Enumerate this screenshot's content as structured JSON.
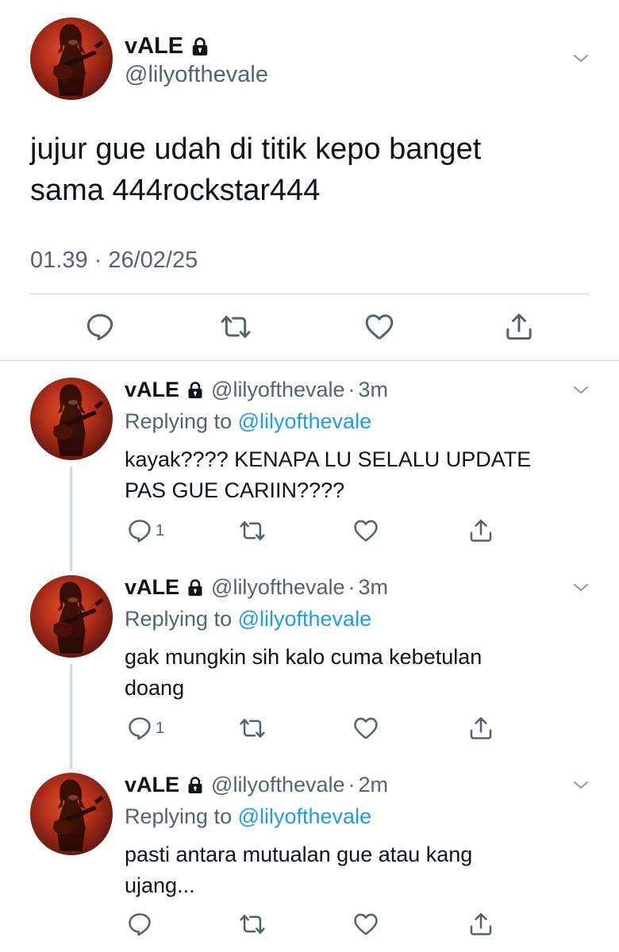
{
  "main_tweet": {
    "name": "vALE",
    "handle": "@lilyofthevale",
    "text_line1": "jujur gue udah di titik kepo banget",
    "text_line2": "sama 444rockstar444",
    "timestamp": "01.39 · 26/02/25",
    "icons": {
      "lock": "lock-icon",
      "chevron": "chevron-down-icon",
      "reply": "reply-icon",
      "retweet": "retweet-icon",
      "like": "heart-icon",
      "share": "share-icon"
    }
  },
  "replies": [
    {
      "name": "vALE",
      "handle": "@lilyofthevale",
      "dot": "·",
      "time": "3m",
      "replying_prefix": "Replying to ",
      "replying_to": "@lilyofthevale",
      "line1": "kayak???? KENAPA LU SELALU UPDATE",
      "line2": "PAS GUE CARIIN????",
      "reply_count": "1"
    },
    {
      "name": "vALE",
      "handle": "@lilyofthevale",
      "dot": "·",
      "time": "3m",
      "replying_prefix": "Replying to ",
      "replying_to": "@lilyofthevale",
      "line1": "gak mungkin sih kalo cuma kebetulan",
      "line2": "doang",
      "reply_count": "1"
    },
    {
      "name": "vALE",
      "handle": "@lilyofthevale",
      "dot": "·",
      "time": "2m",
      "replying_prefix": "Replying to ",
      "replying_to": "@lilyofthevale",
      "line1": "pasti antara mutualan gue atau kang",
      "line2": "ujang...",
      "reply_count": ""
    }
  ],
  "colors": {
    "text": "#0f1419",
    "muted": "#536471",
    "link": "#1d9bf0",
    "divider": "#cfd9de"
  }
}
